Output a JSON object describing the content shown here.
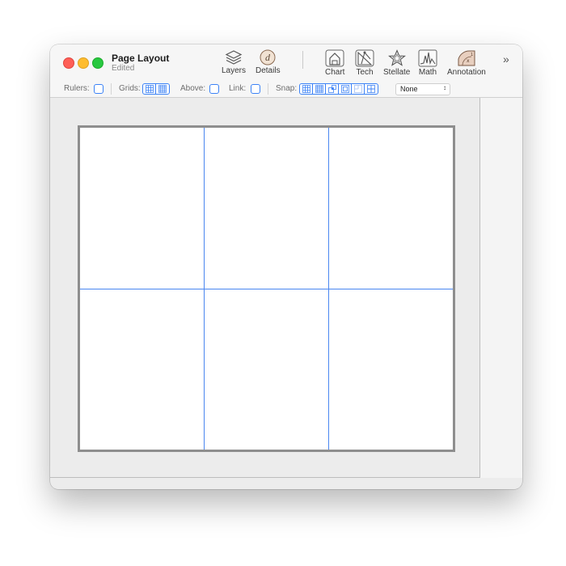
{
  "window": {
    "title": "Page Layout",
    "subtitle": "Edited"
  },
  "toolbar": {
    "layers_label": "Layers",
    "details_label": "Details",
    "chart_label": "Chart",
    "tech_label": "Tech",
    "stellate_label": "Stellate",
    "math_label": "Math",
    "annotation_label": "Annotation",
    "overflow_label": "»"
  },
  "options": {
    "rulers_label": "Rulers:",
    "grids_label": "Grids:",
    "above_label": "Above:",
    "link_label": "Link:",
    "snap_label": "Snap:",
    "snap_mode": "None",
    "rulers_checked": false,
    "above_checked": false,
    "link_checked": false
  },
  "colors": {
    "accent": "#3b82f6",
    "grid_line": "#4a86f0",
    "page_border": "#8e8e8e",
    "close": "#fe5f57",
    "minimize": "#febc2e",
    "zoom": "#28c840"
  },
  "icons": {
    "layers": "layers-icon",
    "details": "details-d-icon",
    "chart": "chart-house-icon",
    "tech": "tech-compass-icon",
    "stellate": "star-icon",
    "math": "math-wave-icon",
    "annotation": "annotation-protractor-icon"
  }
}
